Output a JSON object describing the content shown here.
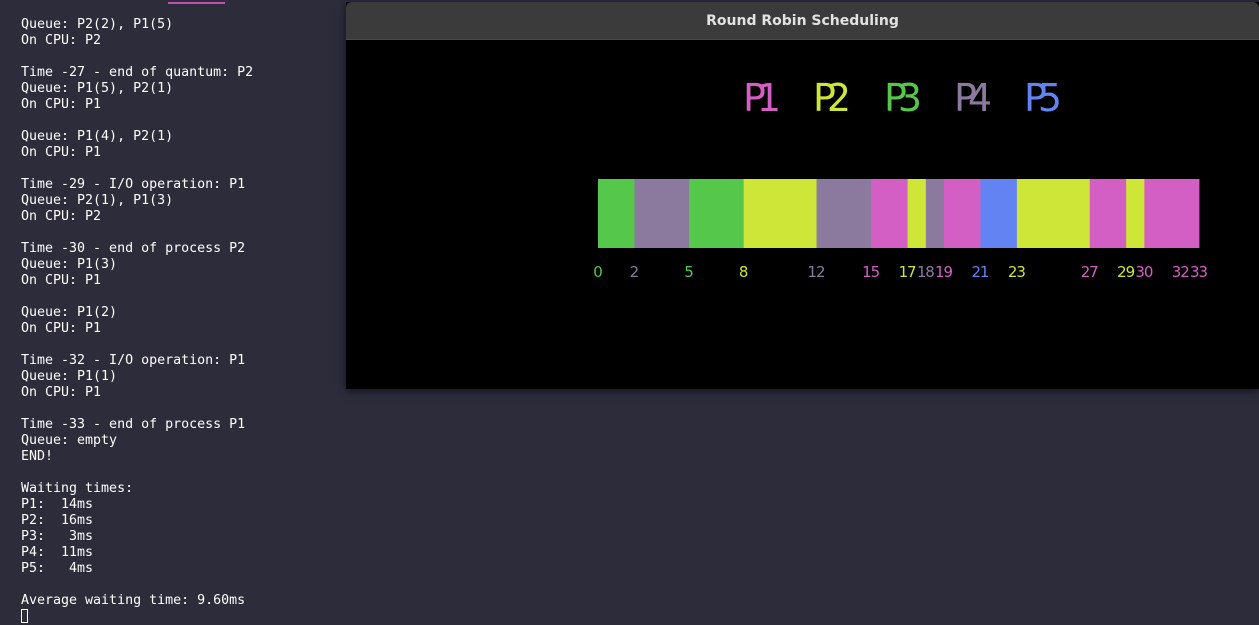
{
  "terminal": {
    "lines": [
      "Queue: P2(2), P1(5)",
      "On CPU: P2",
      "",
      "Time -27 - end of quantum: P2",
      "Queue: P1(5), P2(1)",
      "On CPU: P1",
      "",
      "Queue: P1(4), P2(1)",
      "On CPU: P1",
      "",
      "Time -29 - I/O operation: P1",
      "Queue: P2(1), P1(3)",
      "On CPU: P2",
      "",
      "Time -30 - end of process P2",
      "Queue: P1(3)",
      "On CPU: P1",
      "",
      "Queue: P1(2)",
      "On CPU: P1",
      "",
      "Time -32 - I/O operation: P1",
      "Queue: P1(1)",
      "On CPU: P1",
      "",
      "Time -33 - end of process P1",
      "Queue: empty",
      "END!",
      "",
      "Waiting times:",
      "P1:  14ms",
      "P2:  16ms",
      "P3:   3ms",
      "P4:  11ms",
      "P5:   4ms",
      "",
      "Average waiting time: 9.60ms"
    ]
  },
  "window": {
    "title": "Round Robin Scheduling"
  },
  "colors": {
    "P1": "#d45fc4",
    "P2": "#cee637",
    "P3": "#55c84b",
    "P4": "#8c7a9e",
    "P5": "#6383f3"
  },
  "chart_data": {
    "type": "gantt",
    "legend": [
      "P1",
      "P2",
      "P3",
      "P4",
      "P5"
    ],
    "time_range": [
      0,
      33
    ],
    "segments": [
      {
        "process": "P3",
        "start": 0,
        "end": 2
      },
      {
        "process": "P4",
        "start": 2,
        "end": 5
      },
      {
        "process": "P3",
        "start": 5,
        "end": 8
      },
      {
        "process": "P2",
        "start": 8,
        "end": 12
      },
      {
        "process": "P4",
        "start": 12,
        "end": 15
      },
      {
        "process": "P1",
        "start": 15,
        "end": 17
      },
      {
        "process": "P2",
        "start": 17,
        "end": 18
      },
      {
        "process": "P4",
        "start": 18,
        "end": 19
      },
      {
        "process": "P1",
        "start": 19,
        "end": 21
      },
      {
        "process": "P5",
        "start": 21,
        "end": 23
      },
      {
        "process": "P2",
        "start": 23,
        "end": 27
      },
      {
        "process": "P1",
        "start": 27,
        "end": 29
      },
      {
        "process": "P2",
        "start": 29,
        "end": 30
      },
      {
        "process": "P1",
        "start": 30,
        "end": 33
      }
    ],
    "ticks": [
      {
        "value": 0,
        "label": "0",
        "process": "P3"
      },
      {
        "value": 2,
        "label": "2",
        "process": "P4"
      },
      {
        "value": 5,
        "label": "5",
        "process": "P3"
      },
      {
        "value": 8,
        "label": "8",
        "process": "P2"
      },
      {
        "value": 12,
        "label": "12",
        "process": "P4"
      },
      {
        "value": 15,
        "label": "15",
        "process": "P1"
      },
      {
        "value": 17,
        "label": "17",
        "process": "P2"
      },
      {
        "value": 18,
        "label": "18",
        "process": "P4"
      },
      {
        "value": 19,
        "label": "19",
        "process": "P1"
      },
      {
        "value": 21,
        "label": "21",
        "process": "P5"
      },
      {
        "value": 23,
        "label": "23",
        "process": "P2"
      },
      {
        "value": 27,
        "label": "27",
        "process": "P1"
      },
      {
        "value": 29,
        "label": "29",
        "process": "P2"
      },
      {
        "value": 30,
        "label": "30",
        "process": "P1"
      },
      {
        "value": 32,
        "label": "32",
        "process": "P1"
      },
      {
        "value": 33,
        "label": "33",
        "process": "P1"
      }
    ]
  }
}
